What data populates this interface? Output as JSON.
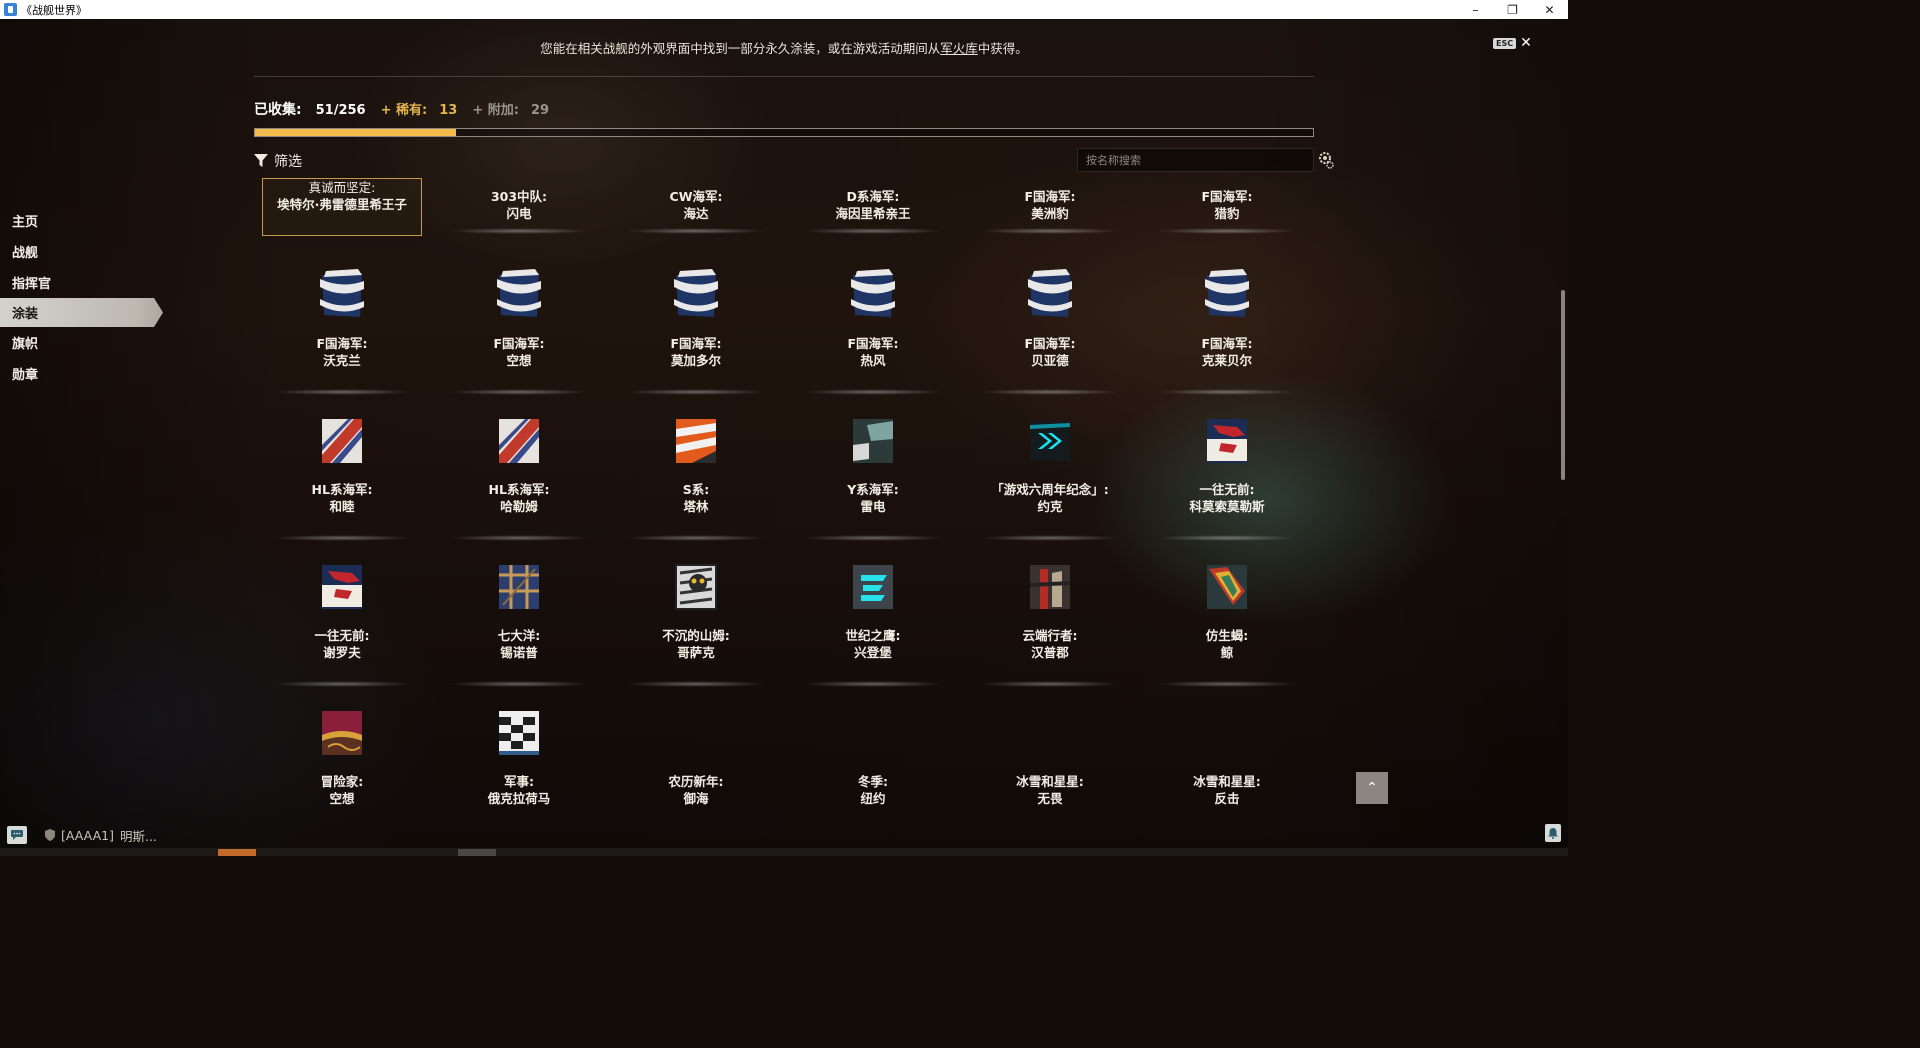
{
  "window": {
    "title": "《战舰世界》",
    "controls": [
      "–",
      "❐",
      "✕"
    ]
  },
  "sidebar": {
    "items": [
      {
        "label": "主页",
        "active": false
      },
      {
        "label": "战舰",
        "active": false
      },
      {
        "label": "指挥官",
        "active": false
      },
      {
        "label": "涂装",
        "active": true
      },
      {
        "label": "旗帜",
        "active": false
      },
      {
        "label": "勋章",
        "active": false
      }
    ]
  },
  "notice": {
    "before": "您能在相关战舰的外观界面中找到一部分永久涂装，或在游戏活动期间从",
    "link": "军火库",
    "after": "中获得。"
  },
  "esc": {
    "key": "ESC",
    "close": "✕"
  },
  "stats": {
    "collected_label": "已收集:",
    "collected_value": "51/256",
    "rare_label": "+ 稀有:",
    "rare_value": "13",
    "extra_label": "+ 附加:",
    "extra_value": "29",
    "progress_fraction": 0.19
  },
  "filter": {
    "label": "筛选"
  },
  "search": {
    "placeholder": "按名称搜索"
  },
  "colors": {
    "accent": "#f2bd4e",
    "rare": "#e2b44e",
    "selected_border": "#c49a48"
  },
  "cards": [
    {
      "line1": "真诚而坚定:",
      "line2": "埃特尔·弗雷德里希王子",
      "icon": "none",
      "selected": true
    },
    {
      "line1": "303中队:",
      "line2": "闪电",
      "icon": "none"
    },
    {
      "line1": "CW海军:",
      "line2": "海达",
      "icon": "none"
    },
    {
      "line1": "D系海军:",
      "line2": "海因里希亲王",
      "icon": "none"
    },
    {
      "line1": "F国海军:",
      "line2": "美洲豹",
      "icon": "none"
    },
    {
      "line1": "F国海军:",
      "line2": "猎豹",
      "icon": "none"
    },
    {
      "line1": "F国海军:",
      "line2": "沃克兰",
      "icon": "french-navy-icon"
    },
    {
      "line1": "F国海军:",
      "line2": "空想",
      "icon": "french-navy-icon"
    },
    {
      "line1": "F国海军:",
      "line2": "莫加多尔",
      "icon": "french-navy-icon"
    },
    {
      "line1": "F国海军:",
      "line2": "热风",
      "icon": "french-navy-icon"
    },
    {
      "line1": "F国海军:",
      "line2": "贝亚德",
      "icon": "french-navy-icon"
    },
    {
      "line1": "F国海军:",
      "line2": "克莱贝尔",
      "icon": "french-navy-icon"
    },
    {
      "line1": "HL系海军:",
      "line2": "和睦",
      "icon": "hl-navy-icon"
    },
    {
      "line1": "HL系海军:",
      "line2": "哈勒姆",
      "icon": "hl-navy-icon"
    },
    {
      "line1": "S系:",
      "line2": "塔林",
      "icon": "s-series-icon"
    },
    {
      "line1": "Y系海军:",
      "line2": "雷电",
      "icon": "y-navy-icon"
    },
    {
      "line1": "「游戏六周年纪念」:",
      "line2": "约克",
      "icon": "anniversary-icon"
    },
    {
      "line1": "一往无前:",
      "line2": "科莫索莫勒斯",
      "icon": "onward-icon"
    },
    {
      "line1": "一往无前:",
      "line2": "谢罗夫",
      "icon": "onward-icon"
    },
    {
      "line1": "七大洋:",
      "line2": "锡诺普",
      "icon": "seven-seas-icon"
    },
    {
      "line1": "不沉的山姆:",
      "line2": "哥萨克",
      "icon": "unsinkable-sam-icon"
    },
    {
      "line1": "世纪之鹰:",
      "line2": "兴登堡",
      "icon": "century-hawk-icon"
    },
    {
      "line1": "云端行者:",
      "line2": "汉普郡",
      "icon": "cloud-walker-icon"
    },
    {
      "line1": "仿生蝎:",
      "line2": "鲸",
      "icon": "bionic-scorpion-icon"
    },
    {
      "line1": "冒险家:",
      "line2": "空想",
      "icon": "adventurer-icon"
    },
    {
      "line1": "军事:",
      "line2": "俄克拉荷马",
      "icon": "military-icon"
    },
    {
      "line1": "农历新年:",
      "line2": "御海",
      "icon": "none"
    },
    {
      "line1": "冬季:",
      "line2": "纽约",
      "icon": "none"
    },
    {
      "line1": "冰雪和星星:",
      "line2": "无畏",
      "icon": "none"
    },
    {
      "line1": "冰雪和星星:",
      "line2": "反击",
      "icon": "none"
    }
  ],
  "to_top": "⌃",
  "chat": {
    "clan_tag": "[AAAA1]",
    "player": "明斯..."
  }
}
